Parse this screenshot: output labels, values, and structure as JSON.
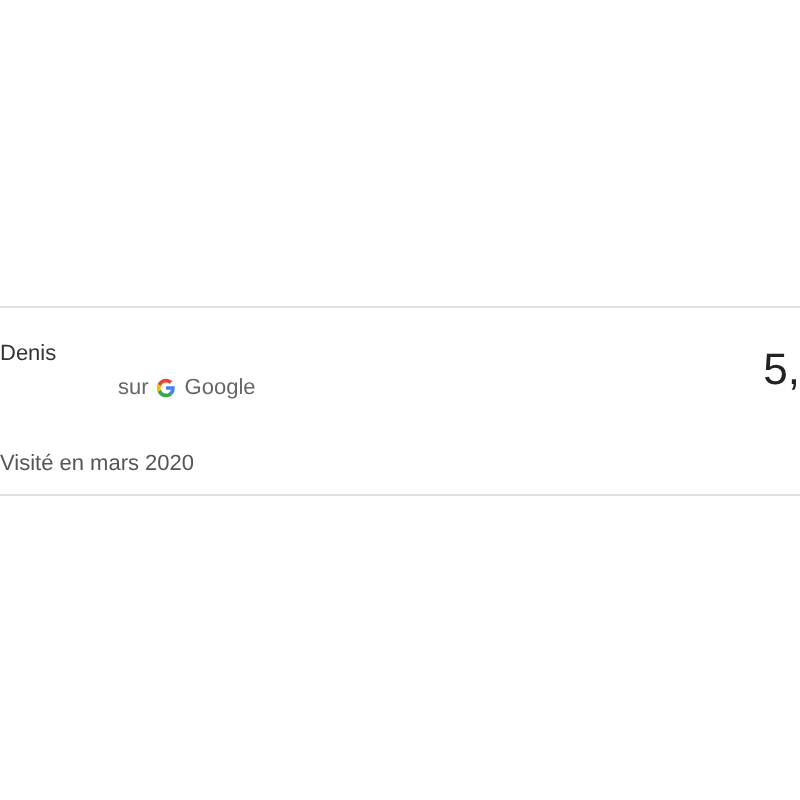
{
  "review": {
    "author": "Denis",
    "source_prefix": "sur",
    "source": "Google",
    "rating": "5,",
    "visited": "Visité en mars 2020"
  }
}
